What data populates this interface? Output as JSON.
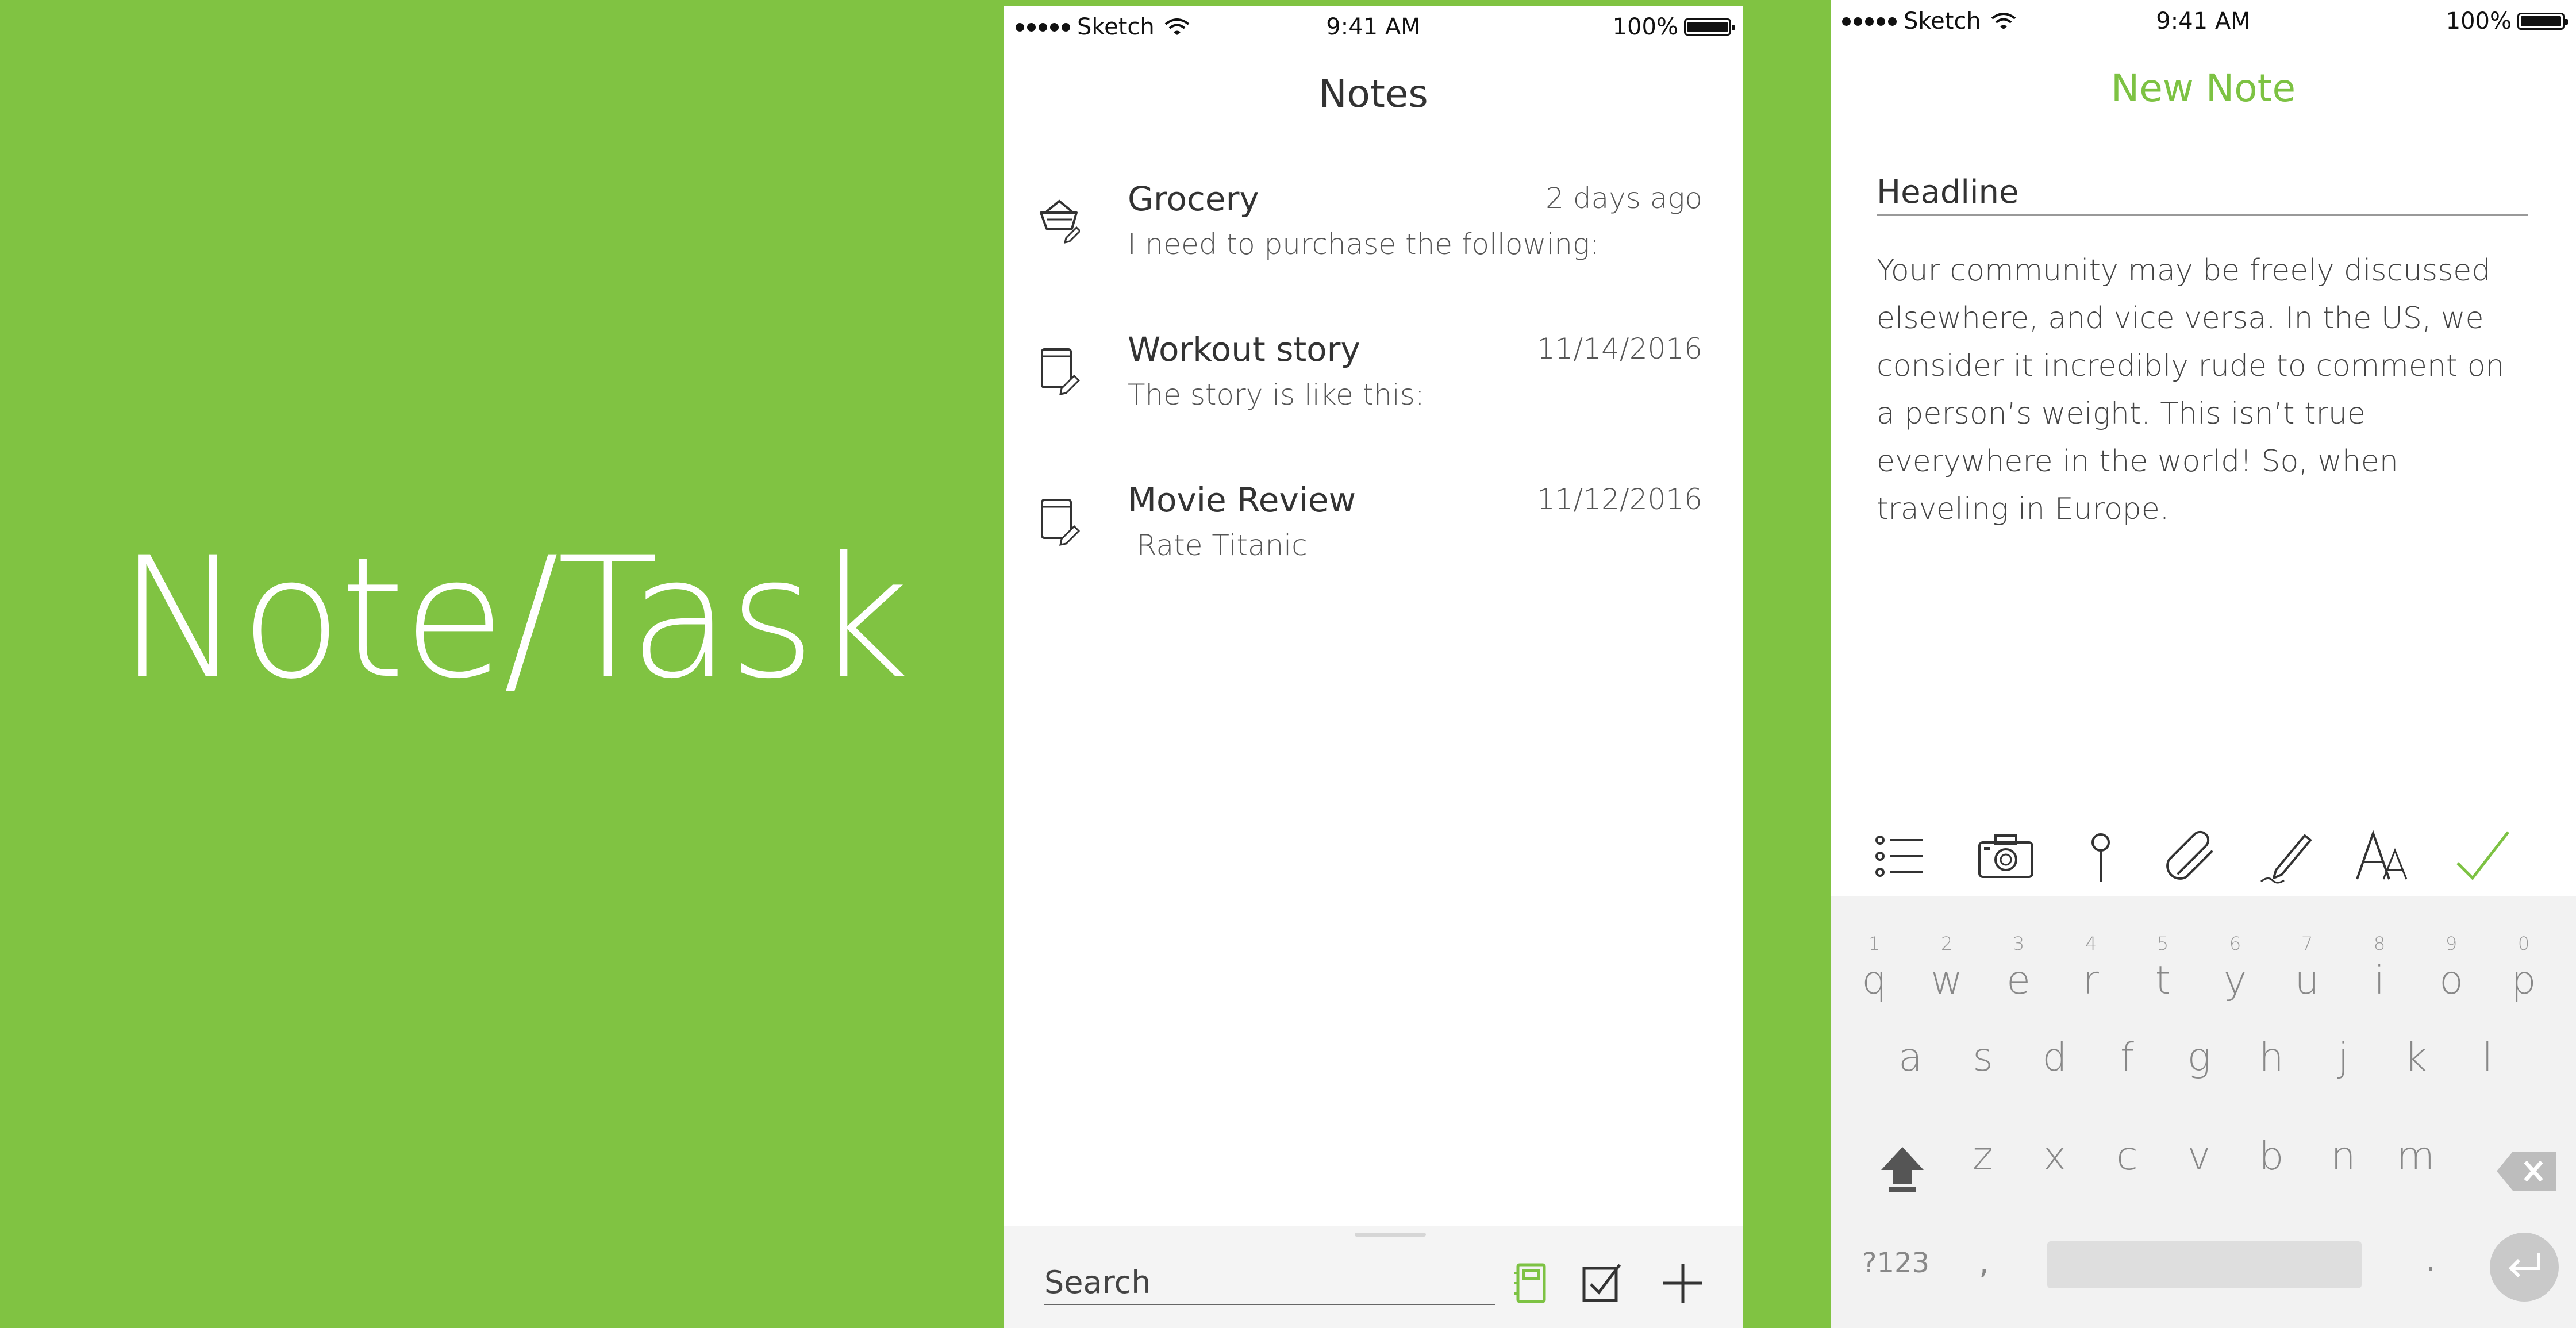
{
  "app_title": "Note/Task",
  "status_bar": {
    "carrier": "Sketch",
    "time": "9:41 AM",
    "battery": "100%"
  },
  "notes_screen": {
    "title": "Notes",
    "notes": [
      {
        "title": "Grocery",
        "preview": "I need to purchase the following:",
        "date": "2 days ago",
        "icon": "basket-edit-icon"
      },
      {
        "title": "Workout story",
        "preview": "The story is like this:",
        "date": "11/14/2016",
        "icon": "notebook-edit-icon"
      },
      {
        "title": "Movie Review",
        "preview": " Rate Titanic",
        "date": "11/12/2016",
        "icon": "notebook-edit-icon"
      }
    ],
    "bottom_bar": {
      "search_placeholder": "Search",
      "buttons": [
        "notebook-icon",
        "checkbox-icon",
        "plus-icon"
      ]
    }
  },
  "new_note_screen": {
    "title": "New Note",
    "headline_placeholder": "Headline",
    "body": "Your community may be freely discussed elsewhere, and vice versa. In the US, we consider it incredibly rude to comment on a person’s weight. This isn’t true everywhere in the world! So, when traveling in Europe.",
    "toolbar": [
      "checklist-icon",
      "camera-icon",
      "location-pin-icon",
      "paperclip-icon",
      "pen-icon",
      "text-format-icon",
      "checkmark-icon"
    ],
    "keyboard": {
      "row1": [
        {
          "num": "1",
          "key": "q"
        },
        {
          "num": "2",
          "key": "w"
        },
        {
          "num": "3",
          "key": "e"
        },
        {
          "num": "4",
          "key": "r"
        },
        {
          "num": "5",
          "key": "t"
        },
        {
          "num": "6",
          "key": "y"
        },
        {
          "num": "7",
          "key": "u"
        },
        {
          "num": "8",
          "key": "i"
        },
        {
          "num": "9",
          "key": "o"
        },
        {
          "num": "0",
          "key": "p"
        }
      ],
      "row2": [
        "a",
        "s",
        "d",
        "f",
        "g",
        "h",
        "j",
        "k",
        "l"
      ],
      "row3": [
        "z",
        "x",
        "c",
        "v",
        "b",
        "n",
        "m"
      ],
      "symbols_key": "?123",
      "comma_key": ",",
      "period_key": "."
    }
  },
  "colors": {
    "brand_green": "#80c342",
    "accent_green": "#7dc243"
  }
}
